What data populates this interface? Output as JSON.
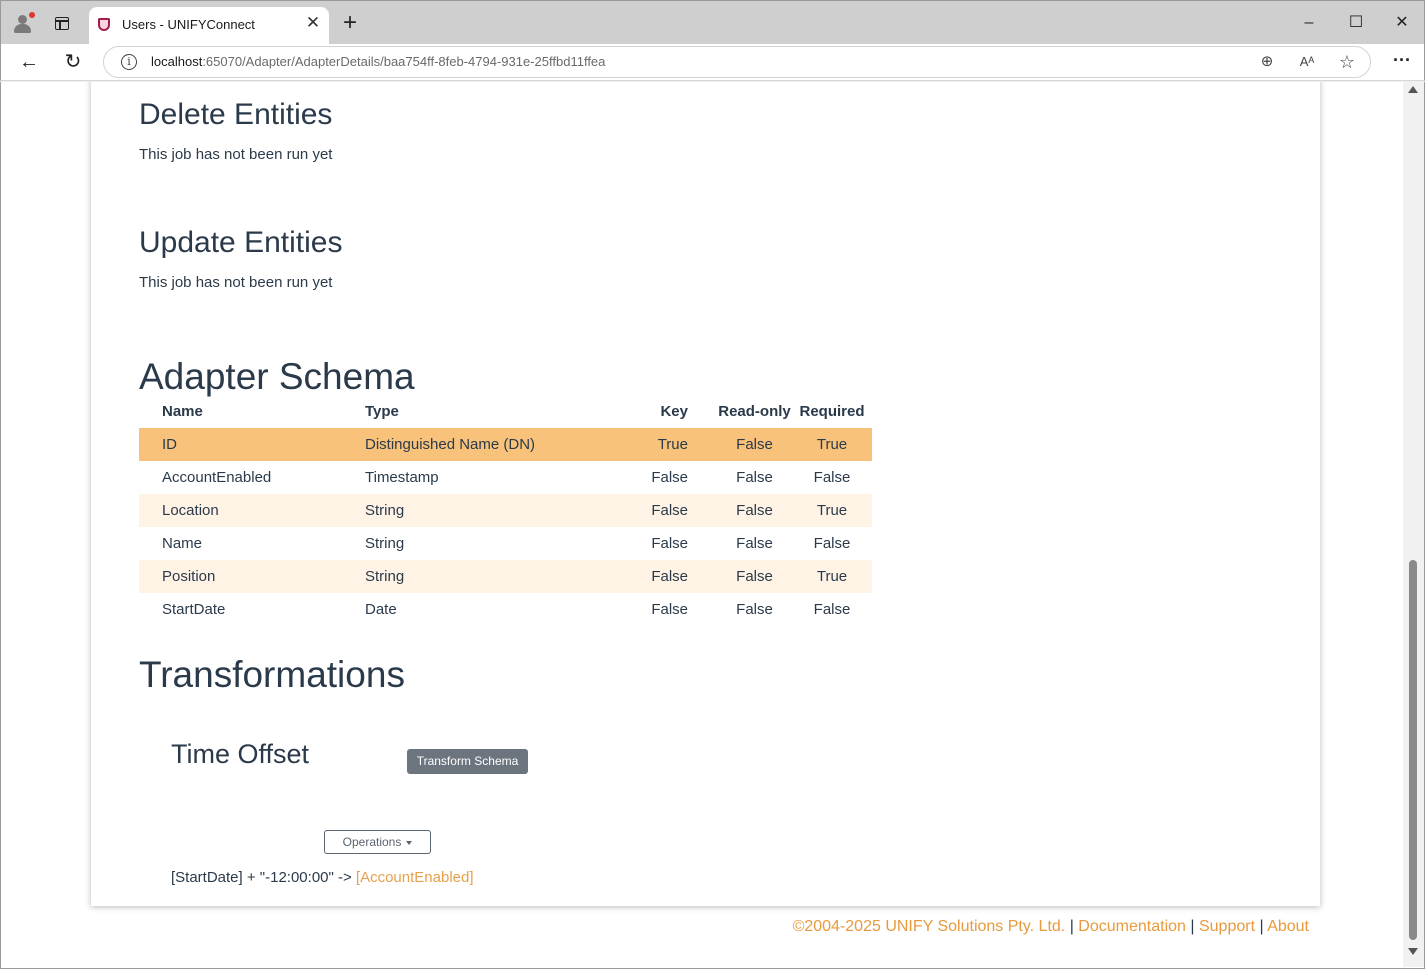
{
  "browser": {
    "tab_title": "Users - UNIFYConnect",
    "url_host": "localhost",
    "url_rest": ":65070/Adapter/AdapterDetails/baa754ff-8feb-4794-931e-25ffbd11ffea",
    "icons": {
      "tab_close": "✕",
      "new_tab": "+",
      "minimize": "–",
      "maximize": "☐",
      "close": "✕",
      "back": "←",
      "refresh": "↻",
      "info": "i",
      "zoom": "⊕",
      "read_aloud": "Aᴬ",
      "favorite": "☆",
      "more": "···"
    }
  },
  "sections": {
    "delete_entities": {
      "title": "Delete Entities",
      "status": "This job has not been run yet"
    },
    "update_entities": {
      "title": "Update Entities",
      "status": "This job has not been run yet"
    },
    "adapter_schema": {
      "title": "Adapter Schema"
    }
  },
  "schema_table": {
    "headers": {
      "name": "Name",
      "type": "Type",
      "key": "Key",
      "readonly": "Read-only",
      "required": "Required"
    },
    "rows": [
      {
        "name": "ID",
        "type": "Distinguished Name (DN)",
        "key": "True",
        "readonly": "False",
        "required": "True"
      },
      {
        "name": "AccountEnabled",
        "type": "Timestamp",
        "key": "False",
        "readonly": "False",
        "required": "False"
      },
      {
        "name": "Location",
        "type": "String",
        "key": "False",
        "readonly": "False",
        "required": "True"
      },
      {
        "name": "Name",
        "type": "String",
        "key": "False",
        "readonly": "False",
        "required": "False"
      },
      {
        "name": "Position",
        "type": "String",
        "key": "False",
        "readonly": "False",
        "required": "True"
      },
      {
        "name": "StartDate",
        "type": "Date",
        "key": "False",
        "readonly": "False",
        "required": "False"
      }
    ]
  },
  "transformations": {
    "title": "Transformations",
    "transform_schema_label": "Transform Schema",
    "item": {
      "title": "Time Offset",
      "operations_label": "Operations",
      "expression": "[StartDate] + \"-12:00:00\" -> ",
      "target": "[AccountEnabled]"
    }
  },
  "footer": {
    "copyright": "©2004-2025 UNIFY Solutions Pty. Ltd.",
    "sep": " | ",
    "documentation": "Documentation",
    "support": "Support",
    "about": "About"
  },
  "colors": {
    "accent": "#e89a3c",
    "selected_row": "#f8c27a",
    "striped_row": "#fff3e6",
    "badge": "#6c757d"
  }
}
